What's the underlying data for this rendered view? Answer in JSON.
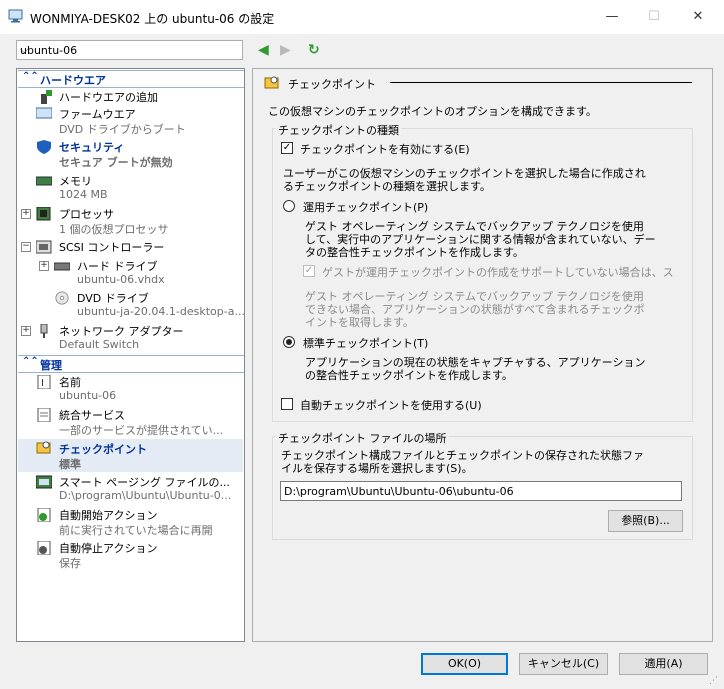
{
  "window": {
    "title": "WONMIYA-DESK02 上の ubuntu-06 の設定",
    "minimize": "—",
    "maximize": "☐",
    "close": "✕"
  },
  "vm_select": {
    "value": "ubuntu-06"
  },
  "nav": {
    "back": "◀",
    "forward": "▶",
    "refresh": "↻"
  },
  "sidebar": {
    "hardware_header": "ハードウエア",
    "management_header": "管理",
    "items": [
      {
        "label": "ハードウエアの追加",
        "sub": ""
      },
      {
        "label": "ファームウエア",
        "sub": "DVD ドライブからブート"
      },
      {
        "label": "セキュリティ",
        "sub": "セキュア ブートが無効"
      },
      {
        "label": "メモリ",
        "sub": "1024 MB"
      },
      {
        "label": "プロセッサ",
        "sub": "1 個の仮想プロセッサ"
      },
      {
        "label": "SCSI コントローラー",
        "sub": ""
      },
      {
        "label": "ハード ドライブ",
        "sub": "ubuntu-06.vhdx"
      },
      {
        "label": "DVD ドライブ",
        "sub": "ubuntu-ja-20.04.1-desktop-a..."
      },
      {
        "label": "ネットワーク アダプター",
        "sub": "Default Switch"
      },
      {
        "label": "名前",
        "sub": "ubuntu-06"
      },
      {
        "label": "統合サービス",
        "sub": "一部のサービスが提供されてい..."
      },
      {
        "label": "チェックポイント",
        "sub": "標準"
      },
      {
        "label": "スマート ページング ファイルの...",
        "sub": "D:\\program\\Ubuntu\\Ubuntu-0..."
      },
      {
        "label": "自動開始アクション",
        "sub": "前に実行されていた場合に再開"
      },
      {
        "label": "自動停止アクション",
        "sub": "保存"
      }
    ]
  },
  "panel": {
    "title": "チェックポイント",
    "description": "この仮想マシンのチェックポイントのオプションを構成できます。",
    "type_group_title": "チェックポイントの種類",
    "enable_checkbox": "チェックポイントを有効にする(E)",
    "select_desc_1": "ユーザーがこの仮想マシンのチェックポイントを選択した場合に作成され",
    "select_desc_2": "るチェックポイントの種類を選択します。",
    "production_radio": "運用チェックポイント(P)",
    "production_desc_1": "ゲスト オペレーティング システムでバックアップ テクノロジを使用",
    "production_desc_2": "して、実行中のアプリケーションに関する情報が含まれていない、デー",
    "production_desc_3": "タの整合性チェックポイントを作成します。",
    "fallback_checkbox": "ゲストが運用チェックポイントの作成をサポートしていない場合は、ス",
    "fallback_desc_1": "ゲスト オペレーティング システムでバックアップ テクノロジを使用",
    "fallback_desc_2": "できない場合、アプリケーションの状態がすべて含まれるチェックポ",
    "fallback_desc_3": "イントを取得します。",
    "standard_radio": "標準チェックポイント(T)",
    "standard_desc_1": "アプリケーションの現在の状態をキャプチャする、アプリケーション",
    "standard_desc_2": "の整合性チェックポイントを作成します。",
    "auto_checkbox": "自動チェックポイントを使用する(U)",
    "location_group_title": "チェックポイント ファイルの場所",
    "location_desc_1": "チェックポイント構成ファイルとチェックポイントの保存された状態ファ",
    "location_desc_2": "イルを保存する場所を選択します(S)。",
    "path_value": "D:\\program\\Ubuntu\\Ubuntu-06\\ubuntu-06",
    "browse_button": "参照(B)..."
  },
  "footer": {
    "ok": "OK(O)",
    "cancel": "キャンセル(C)",
    "apply": "適用(A)"
  },
  "colors": {
    "accent": "#0078d7",
    "section_blue": "#003399"
  }
}
